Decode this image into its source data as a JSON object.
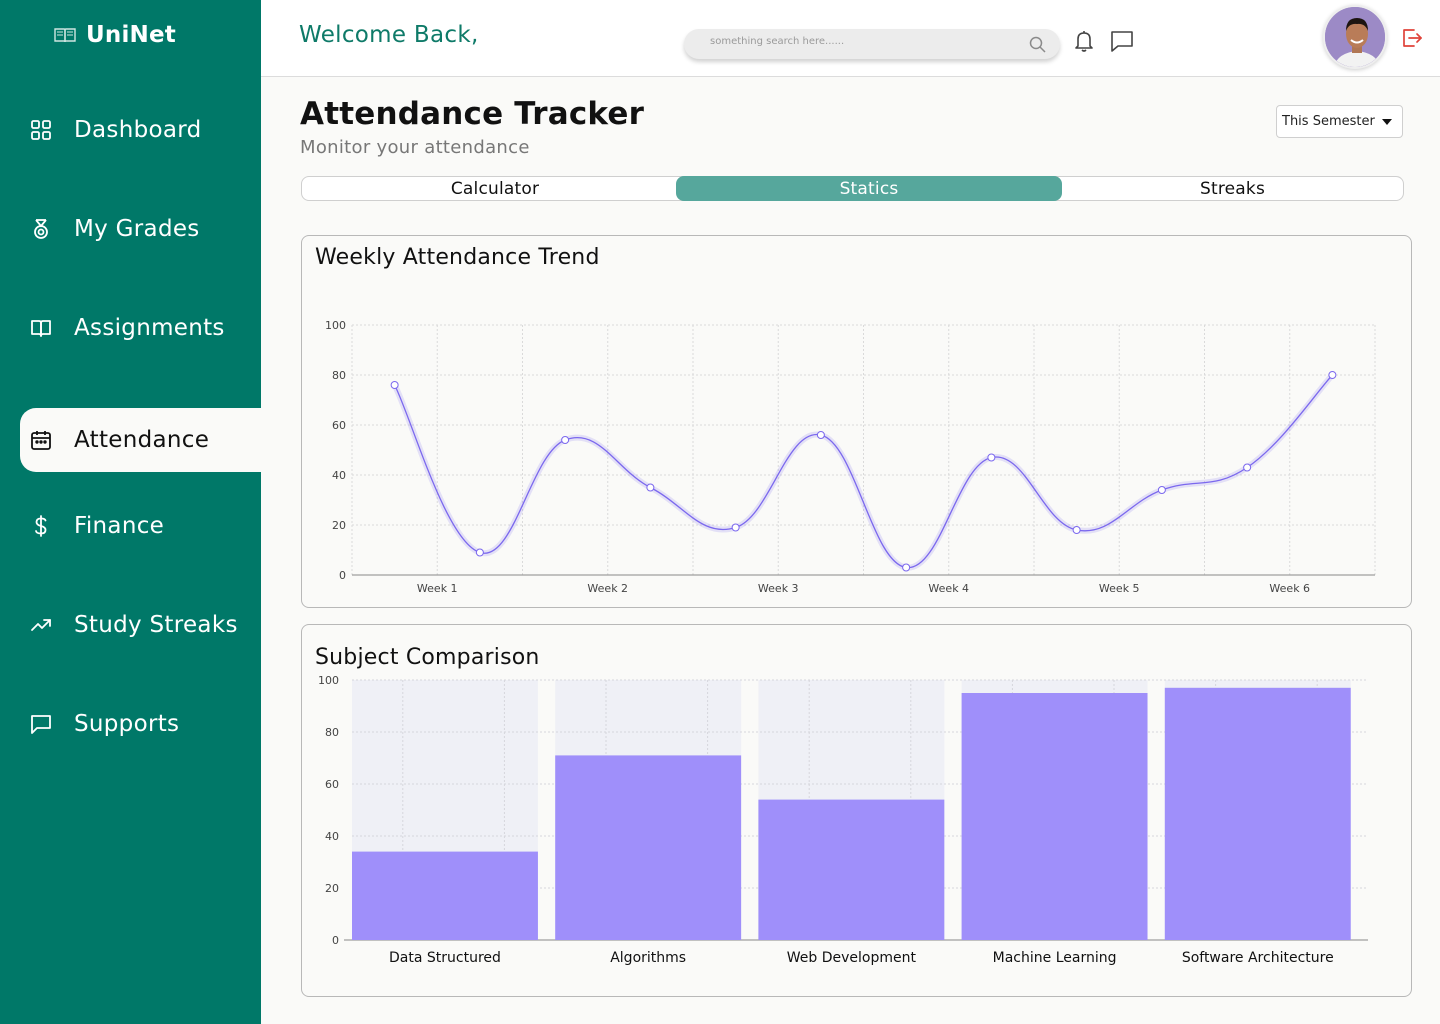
{
  "brand": {
    "name": "UniNet"
  },
  "sidebar": {
    "items": [
      {
        "label": "Dashboard",
        "icon": "grid-icon"
      },
      {
        "label": "My Grades",
        "icon": "medal-icon"
      },
      {
        "label": "Assignments",
        "icon": "book-icon"
      },
      {
        "label": "Attendance",
        "icon": "calendar-icon",
        "active": true
      },
      {
        "label": "Finance",
        "icon": "dollar-icon"
      },
      {
        "label": "Study Streaks",
        "icon": "trending-up-icon"
      },
      {
        "label": "Supports",
        "icon": "chat-icon"
      }
    ]
  },
  "header": {
    "welcome": "Welcome Back,",
    "search_placeholder": "something search here......"
  },
  "page": {
    "title": "Attendance Tracker",
    "subtitle": "Monitor your attendance",
    "period": "This Semester"
  },
  "tabs": [
    {
      "label": "Calculator"
    },
    {
      "label": "Statics",
      "active": true
    },
    {
      "label": "Streaks"
    }
  ],
  "colors": {
    "sidebar": "#007868",
    "accent": "#56a79c",
    "line": "#7b68ee",
    "bar": "#9f8ffa",
    "bar_track": "#eff0f6",
    "logout": "#e0433a"
  },
  "chart_data": [
    {
      "type": "line",
      "title": "Weekly Attendance Trend",
      "categories": [
        "Week 1",
        "Week 2",
        "Week 3",
        "Week 4",
        "Week 5",
        "Week 6"
      ],
      "x": [
        0.5,
        1,
        1.5,
        2,
        2.5,
        3,
        3.5,
        4,
        4.5,
        5,
        5.5,
        6
      ],
      "values": [
        76,
        9,
        54,
        35,
        19,
        56,
        3,
        47,
        18,
        34,
        43,
        80
      ],
      "ylim": [
        0,
        100
      ],
      "yticks": [
        0,
        20,
        40,
        60,
        80,
        100
      ],
      "grid": true,
      "smooth": true
    },
    {
      "type": "bar",
      "title": "Subject Comparison",
      "categories": [
        "Data Structured",
        "Algorithms",
        "Web Development",
        "Machine Learning",
        "Software Architecture"
      ],
      "values": [
        34,
        71,
        54,
        95,
        97
      ],
      "ylim": [
        0,
        100
      ],
      "yticks": [
        0,
        20,
        40,
        60,
        80,
        100
      ],
      "grid": true
    }
  ]
}
